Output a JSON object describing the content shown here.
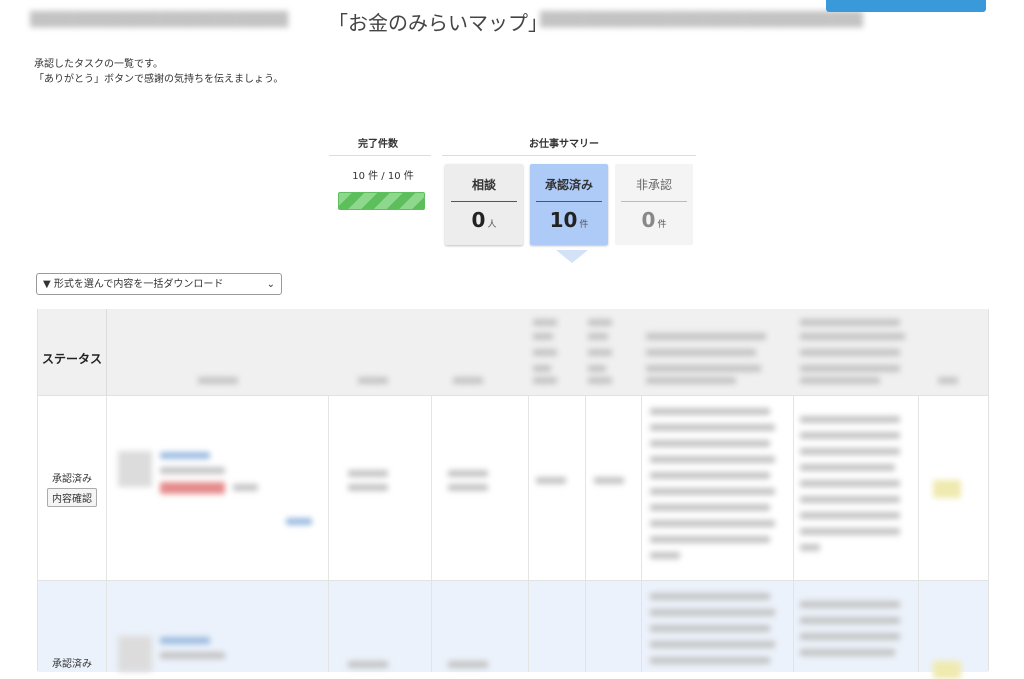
{
  "page": {
    "title": "「お金のみらいマップ」"
  },
  "description": {
    "line1": "承認したタスクの一覧です。",
    "line2": "「ありがとう」ボタンで感謝の気持ちを伝えましょう。"
  },
  "summary": {
    "completed_header": "完了件数",
    "completed_count": "10 件 / 10 件",
    "progress_fraction": 1.0,
    "work_summary_header": "お仕事サマリー",
    "cards": [
      {
        "label": "相談",
        "value": "0",
        "unit": "人",
        "state": "normal"
      },
      {
        "label": "承認済み",
        "value": "10",
        "unit": "件",
        "state": "active"
      },
      {
        "label": "非承認",
        "value": "0",
        "unit": "件",
        "state": "inactive"
      }
    ]
  },
  "download_select": {
    "selected": "▼ 形式を選んで内容を一括ダウンロード"
  },
  "table": {
    "status_header": "ステータス",
    "rows": [
      {
        "status": "承認済み",
        "detail_button": "内容確認"
      },
      {
        "status": "承認済み"
      }
    ]
  },
  "colors": {
    "accent_blue": "#aecbf7",
    "progress_green": "#5cbf5c",
    "row_highlight": "#ecf2fb"
  }
}
